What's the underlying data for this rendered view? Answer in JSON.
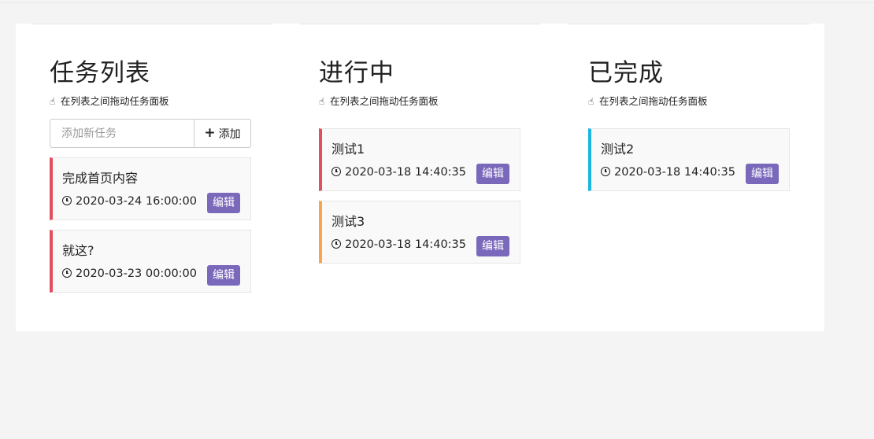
{
  "columns": [
    {
      "title": "任务列表",
      "hint": "在列表之间拖动任务面板",
      "add": {
        "placeholder": "添加新任务",
        "button_label": "添加"
      },
      "cards": [
        {
          "title": "完成首页内容",
          "time": "2020-03-24 16:00:00",
          "edit_label": "编辑",
          "color": "#e25060"
        },
        {
          "title": "就这?",
          "time": "2020-03-23 00:00:00",
          "edit_label": "编辑",
          "color": "#e25060"
        }
      ]
    },
    {
      "title": "进行中",
      "hint": "在列表之间拖动任务面板",
      "cards": [
        {
          "title": "测试1",
          "time": "2020-03-18 14:40:35",
          "edit_label": "编辑",
          "color": "#e25060"
        },
        {
          "title": "测试3",
          "time": "2020-03-18 14:40:35",
          "edit_label": "编辑",
          "color": "#f9a64a"
        }
      ]
    },
    {
      "title": "已完成",
      "hint": "在列表之间拖动任务面板",
      "cards": [
        {
          "title": "测试2",
          "time": "2020-03-18 14:40:35",
          "edit_label": "编辑",
          "color": "#1ab7e0"
        }
      ]
    }
  ],
  "colors": {
    "edit_button": "#7a68bb",
    "board_bg": "#ffffff",
    "page_bg": "#f4f4f4"
  }
}
